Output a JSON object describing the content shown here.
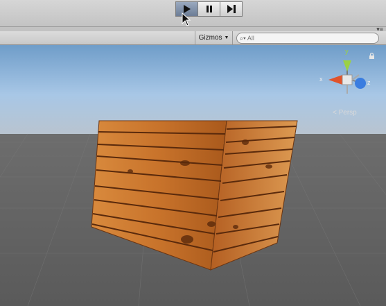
{
  "toolbar": {
    "play_label": "Play",
    "pause_label": "Pause",
    "step_label": "Step",
    "play_icon": "play-icon",
    "pause_icon": "pause-icon",
    "step_icon": "step-icon",
    "play_active": true
  },
  "scene": {
    "gizmos_label": "Gizmos",
    "gizmos_dropdown_icon": "chevron-down-icon",
    "search_placeholder": "All",
    "search_icon": "search-icon",
    "panel_menu_icon": "menu-icon"
  },
  "view_gizmo": {
    "axes": {
      "x": "x",
      "y": "y",
      "z": "z"
    },
    "projection_label": "Persp",
    "colors": {
      "x": "#e0532b",
      "y": "#9bd146",
      "z": "#3a7de0"
    }
  },
  "colors": {
    "sky": "#a9c8e6",
    "ground": "#5e5e5e",
    "wood": "#c9762e"
  }
}
